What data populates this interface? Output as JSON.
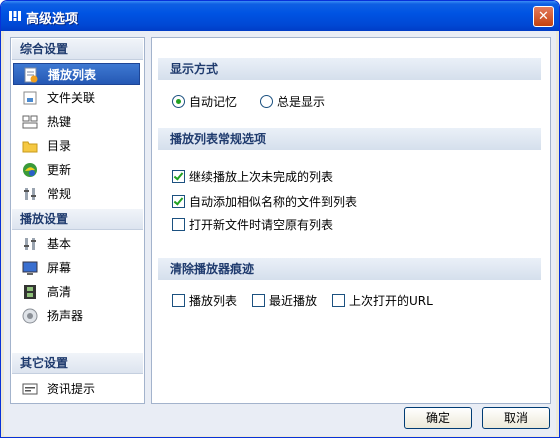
{
  "window": {
    "title": "高级选项",
    "close_glyph": "✕"
  },
  "sidebar": {
    "sections": [
      {
        "label": "综合设置"
      },
      {
        "label": "播放设置"
      },
      {
        "label": "其它设置"
      }
    ],
    "items": [
      {
        "label": "播放列表",
        "icon": "playlist-icon",
        "selected": true
      },
      {
        "label": "文件关联",
        "icon": "file-association-icon"
      },
      {
        "label": "热键",
        "icon": "hotkey-icon"
      },
      {
        "label": "目录",
        "icon": "folder-icon"
      },
      {
        "label": "更新",
        "icon": "update-icon"
      },
      {
        "label": "常规",
        "icon": "general-icon"
      },
      {
        "label": "基本",
        "icon": "basic-icon"
      },
      {
        "label": "屏幕",
        "icon": "screen-icon"
      },
      {
        "label": "高清",
        "icon": "hd-film-icon"
      },
      {
        "label": "扬声器",
        "icon": "speaker-icon"
      },
      {
        "label": "资讯提示",
        "icon": "info-tip-icon"
      }
    ]
  },
  "panel": {
    "display_mode": {
      "title": "显示方式",
      "options": [
        {
          "label": "自动记忆",
          "checked": true
        },
        {
          "label": "总是显示",
          "checked": false
        }
      ]
    },
    "playlist_options": {
      "title": "播放列表常规选项",
      "options": [
        {
          "label": "继续播放上次未完成的列表",
          "checked": true
        },
        {
          "label": "自动添加相似名称的文件到列表",
          "checked": true
        },
        {
          "label": "打开新文件时请空原有列表",
          "checked": false
        }
      ]
    },
    "clear_traces": {
      "title": "清除播放器痕迹",
      "options": [
        {
          "label": "播放列表",
          "checked": false
        },
        {
          "label": "最近播放",
          "checked": false
        },
        {
          "label": "上次打开的URL",
          "checked": false
        }
      ]
    }
  },
  "footer": {
    "ok_label": "确定",
    "cancel_label": "取消"
  }
}
